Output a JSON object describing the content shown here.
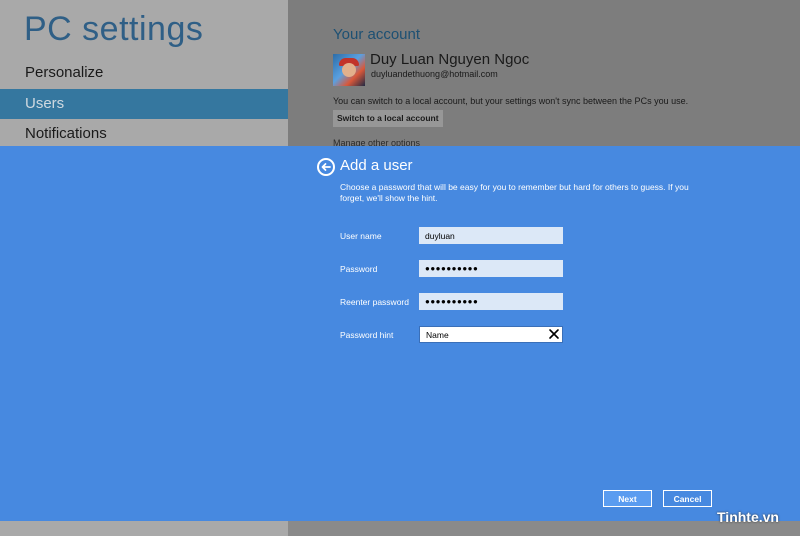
{
  "settings": {
    "title": "PC settings",
    "nav": [
      {
        "label": "Personalize",
        "selected": false
      },
      {
        "label": "Users",
        "selected": true
      },
      {
        "label": "Notifications",
        "selected": false
      }
    ]
  },
  "account": {
    "heading": "Your account",
    "name": "Duy Luan Nguyen Ngoc",
    "email": "duyluandethuong@hotmail.com",
    "note": "You can switch to a local account, but your settings won't sync between the PCs you use.",
    "switch_label": "Switch to a local account",
    "peek_text": "Manage other options"
  },
  "dialog": {
    "title": "Add a user",
    "description": "Choose a password that will be easy for you to remember but hard for others to guess. If you forget, we'll show the hint.",
    "fields": {
      "username": {
        "label": "User name",
        "value": "duyluan"
      },
      "password": {
        "label": "Password",
        "value": "●●●●●●●●●●"
      },
      "reenter": {
        "label": "Reenter password",
        "value": "●●●●●●●●●●"
      },
      "hint": {
        "label": "Password hint",
        "value": "Name"
      }
    },
    "next_label": "Next",
    "cancel_label": "Cancel"
  },
  "watermark": "Tinhte.vn",
  "colors": {
    "dialog_bg": "#4789e0",
    "nav_selected": "#35779f",
    "title_color": "#2f5f86"
  },
  "icons": {
    "back": "arrow-left-circle",
    "clear": "x-mark"
  }
}
